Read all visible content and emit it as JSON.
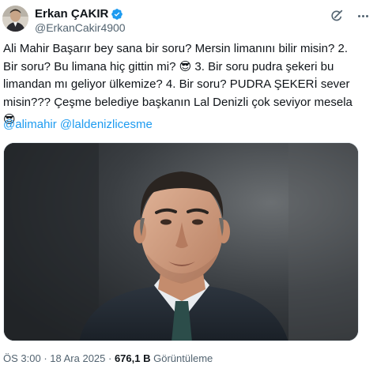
{
  "author": {
    "display_name": "Erkan ÇAKIR",
    "handle": "@ErkanCakir4900",
    "verified_color": "#1d9bf0"
  },
  "header_icons": [
    "grok-icon",
    "more-icon"
  ],
  "tweet": {
    "text": "Ali Mahir Başarır bey sana bir soru? Mersin limanını bilir misin? 2. Bir soru? Bu limana hiç gittin mi? 😎 3. Bir soru pudra şekeri bu limandan mı geliyor ülkemize? 4. Bir soru? PUDRA ŞEKERİ sever misin??? Çeşme belediye başkanın Lal Denizli çok seviyor mesela 😎",
    "mentions": [
      "@alimahir",
      "@laldenizlicesme"
    ]
  },
  "meta": {
    "time": "ÖS 3:00",
    "separator": " · ",
    "date": "18 Ara 2025",
    "views_count": "676,1 B",
    "views_label": "Görüntüleme"
  },
  "colors": {
    "text": "#0f1419",
    "secondary": "#536471",
    "link": "#1d9bf0"
  }
}
